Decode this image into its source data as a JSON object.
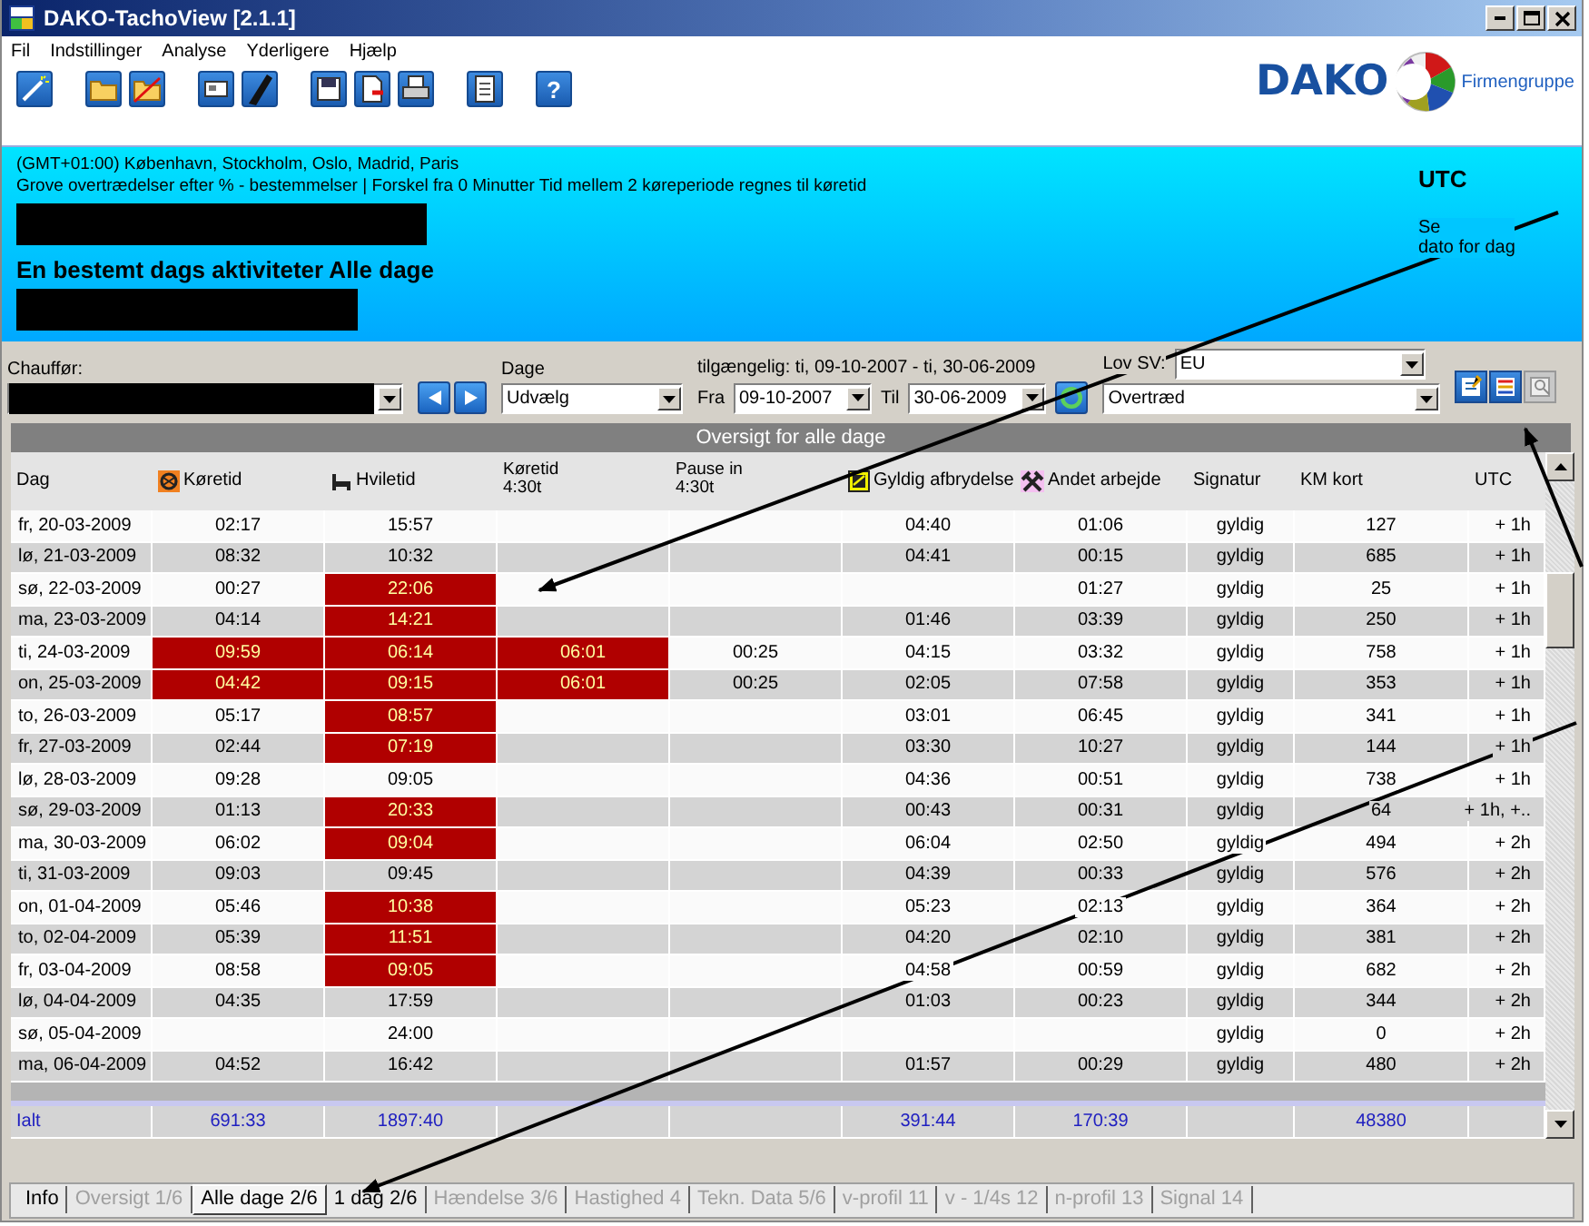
{
  "window": {
    "title": "DAKO-TachoView [2.1.1]"
  },
  "menu": [
    "Fil",
    "Indstillinger",
    "Analyse",
    "Yderligere",
    "Hjælp"
  ],
  "toolbar": [
    [
      {
        "kind": "wand"
      }
    ],
    [
      {
        "kind": "folder"
      },
      {
        "kind": "folder-cross"
      }
    ],
    [
      {
        "kind": "card"
      },
      {
        "kind": "pen"
      }
    ],
    [
      {
        "kind": "save"
      },
      {
        "kind": "export"
      },
      {
        "kind": "print"
      }
    ],
    [
      {
        "kind": "document"
      }
    ],
    [
      {
        "kind": "help",
        "label": "?"
      }
    ]
  ],
  "logo": {
    "text": "DAKO",
    "subtitle": "Firmengruppe"
  },
  "info": {
    "timezone": "(GMT+01:00) København, Stockholm, Oslo, Madrid, Paris",
    "rules": "Grove overtrædelser efter % - bestemmelser | Forskel fra 0 Minutter Tid mellem 2 køreperiode regnes til køretid",
    "heading": "En bestemt dags aktiviteter Alle dage",
    "utc_label": "UTC",
    "date_hint": [
      "Se",
      "dato for dag"
    ]
  },
  "filters": {
    "driver_label": "Chauffør:",
    "days_label": "Dage",
    "days_value": "Udvælg",
    "available": "tilgængelig: ti, 09-10-2007 - ti, 30-06-2009",
    "from_label": "Fra",
    "from_value": "09-10-2007",
    "to_label": "Til",
    "to_value": "30-06-2009",
    "law_label": "Lov SV:",
    "law_value": "EU",
    "mode_value": "Overtræd",
    "view_buttons": [
      {
        "kind": "edit",
        "disabled": false
      },
      {
        "kind": "list",
        "disabled": false
      },
      {
        "kind": "preview",
        "disabled": true
      }
    ]
  },
  "table": {
    "title": "Oversigt for alle dage",
    "columns": [
      {
        "lines": [
          "Dag"
        ],
        "kind": "plain"
      },
      {
        "lines": [
          "Køretid"
        ],
        "kind": "driving"
      },
      {
        "lines": [
          "Hviletid"
        ],
        "kind": "rest"
      },
      {
        "lines": [
          "Køretid",
          "4:30t"
        ],
        "kind": "plain"
      },
      {
        "lines": [
          "Pause in",
          "4:30t"
        ],
        "kind": "plain"
      },
      {
        "lines": [
          "Gyldig afbrydelse"
        ],
        "kind": "break"
      },
      {
        "lines": [
          "Andet arbejde"
        ],
        "kind": "work"
      },
      {
        "lines": [
          "Signatur"
        ],
        "kind": "plain"
      },
      {
        "lines": [
          "KM kort"
        ],
        "kind": "plain"
      },
      {
        "lines": [
          "UTC"
        ],
        "kind": "plain"
      }
    ],
    "rows": [
      {
        "cells": [
          {
            "text": "fr, 20-03-2009"
          },
          {
            "text": "02:17",
            "violation": false
          },
          {
            "text": "15:57",
            "violation": false
          },
          {
            "violation": false
          },
          {},
          {
            "text": "04:40"
          },
          {
            "text": "01:06"
          },
          {
            "text": "gyldig"
          },
          {
            "text": "127"
          },
          {
            "text": "+ 1h"
          }
        ]
      },
      {
        "cells": [
          {
            "text": "lø, 21-03-2009"
          },
          {
            "text": "08:32",
            "violation": false
          },
          {
            "text": "10:32",
            "violation": false
          },
          {
            "violation": false
          },
          {},
          {
            "text": "04:41"
          },
          {
            "text": "00:15"
          },
          {
            "text": "gyldig"
          },
          {
            "text": "685"
          },
          {
            "text": "+ 1h"
          }
        ]
      },
      {
        "cells": [
          {
            "text": "sø, 22-03-2009"
          },
          {
            "text": "00:27",
            "violation": false
          },
          {
            "text": "22:06",
            "violation": true
          },
          {
            "violation": false
          },
          {},
          {},
          {
            "text": "01:27"
          },
          {
            "text": "gyldig"
          },
          {
            "text": "25"
          },
          {
            "text": "+ 1h"
          }
        ]
      },
      {
        "cells": [
          {
            "text": "ma, 23-03-2009"
          },
          {
            "text": "04:14",
            "violation": false
          },
          {
            "text": "14:21",
            "violation": true
          },
          {
            "violation": false
          },
          {},
          {
            "text": "01:46"
          },
          {
            "text": "03:39"
          },
          {
            "text": "gyldig"
          },
          {
            "text": "250"
          },
          {
            "text": "+ 1h"
          }
        ]
      },
      {
        "cells": [
          {
            "text": "ti, 24-03-2009"
          },
          {
            "text": "09:59",
            "violation": true
          },
          {
            "text": "06:14",
            "violation": true
          },
          {
            "text": "06:01",
            "violation": true
          },
          {
            "text": "00:25"
          },
          {
            "text": "04:15"
          },
          {
            "text": "03:32"
          },
          {
            "text": "gyldig"
          },
          {
            "text": "758"
          },
          {
            "text": "+ 1h"
          }
        ]
      },
      {
        "cells": [
          {
            "text": "on, 25-03-2009"
          },
          {
            "text": "04:42",
            "violation": true
          },
          {
            "text": "09:15",
            "violation": true
          },
          {
            "text": "06:01",
            "violation": true
          },
          {
            "text": "00:25"
          },
          {
            "text": "02:05"
          },
          {
            "text": "07:58"
          },
          {
            "text": "gyldig"
          },
          {
            "text": "353"
          },
          {
            "text": "+ 1h"
          }
        ]
      },
      {
        "cells": [
          {
            "text": "to, 26-03-2009"
          },
          {
            "text": "05:17",
            "violation": false
          },
          {
            "text": "08:57",
            "violation": true
          },
          {
            "violation": false
          },
          {},
          {
            "text": "03:01"
          },
          {
            "text": "06:45"
          },
          {
            "text": "gyldig"
          },
          {
            "text": "341"
          },
          {
            "text": "+ 1h"
          }
        ]
      },
      {
        "cells": [
          {
            "text": "fr, 27-03-2009"
          },
          {
            "text": "02:44",
            "violation": false
          },
          {
            "text": "07:19",
            "violation": true
          },
          {
            "violation": false
          },
          {},
          {
            "text": "03:30"
          },
          {
            "text": "10:27"
          },
          {
            "text": "gyldig"
          },
          {
            "text": "144"
          },
          {
            "text": "+ 1h"
          }
        ]
      },
      {
        "cells": [
          {
            "text": "lø, 28-03-2009"
          },
          {
            "text": "09:28",
            "violation": false
          },
          {
            "text": "09:05",
            "violation": false
          },
          {
            "violation": false
          },
          {},
          {
            "text": "04:36"
          },
          {
            "text": "00:51"
          },
          {
            "text": "gyldig"
          },
          {
            "text": "738"
          },
          {
            "text": "+ 1h"
          }
        ]
      },
      {
        "cells": [
          {
            "text": "sø, 29-03-2009"
          },
          {
            "text": "01:13",
            "violation": false
          },
          {
            "text": "20:33",
            "violation": true
          },
          {
            "violation": false
          },
          {},
          {
            "text": "00:43"
          },
          {
            "text": "00:31"
          },
          {
            "text": "gyldig"
          },
          {
            "text": "64"
          },
          {
            "text": "+ 1h, +.."
          }
        ]
      },
      {
        "cells": [
          {
            "text": "ma, 30-03-2009"
          },
          {
            "text": "06:02",
            "violation": false
          },
          {
            "text": "09:04",
            "violation": true
          },
          {
            "violation": false
          },
          {},
          {
            "text": "06:04"
          },
          {
            "text": "02:50"
          },
          {
            "text": "gyldig"
          },
          {
            "text": "494"
          },
          {
            "text": "+ 2h"
          }
        ]
      },
      {
        "cells": [
          {
            "text": "ti, 31-03-2009"
          },
          {
            "text": "09:03",
            "violation": false
          },
          {
            "text": "09:45",
            "violation": false
          },
          {
            "violation": false
          },
          {},
          {
            "text": "04:39"
          },
          {
            "text": "00:33"
          },
          {
            "text": "gyldig"
          },
          {
            "text": "576"
          },
          {
            "text": "+ 2h"
          }
        ]
      },
      {
        "cells": [
          {
            "text": "on, 01-04-2009"
          },
          {
            "text": "05:46",
            "violation": false
          },
          {
            "text": "10:38",
            "violation": true
          },
          {
            "violation": false
          },
          {},
          {
            "text": "05:23"
          },
          {
            "text": "02:13"
          },
          {
            "text": "gyldig"
          },
          {
            "text": "364"
          },
          {
            "text": "+ 2h"
          }
        ]
      },
      {
        "cells": [
          {
            "text": "to, 02-04-2009"
          },
          {
            "text": "05:39",
            "violation": false
          },
          {
            "text": "11:51",
            "violation": true
          },
          {
            "violation": false
          },
          {},
          {
            "text": "04:20"
          },
          {
            "text": "02:10"
          },
          {
            "text": "gyldig"
          },
          {
            "text": "381"
          },
          {
            "text": "+ 2h"
          }
        ]
      },
      {
        "cells": [
          {
            "text": "fr, 03-04-2009"
          },
          {
            "text": "08:58",
            "violation": false
          },
          {
            "text": "09:05",
            "violation": true
          },
          {
            "violation": false
          },
          {},
          {
            "text": "04:58"
          },
          {
            "text": "00:59"
          },
          {
            "text": "gyldig"
          },
          {
            "text": "682"
          },
          {
            "text": "+ 2h"
          }
        ]
      },
      {
        "cells": [
          {
            "text": "lø, 04-04-2009"
          },
          {
            "text": "04:35",
            "violation": false
          },
          {
            "text": "17:59",
            "violation": false
          },
          {
            "violation": false
          },
          {},
          {
            "text": "01:03"
          },
          {
            "text": "00:23"
          },
          {
            "text": "gyldig"
          },
          {
            "text": "344"
          },
          {
            "text": "+ 2h"
          }
        ]
      },
      {
        "cells": [
          {
            "text": "sø, 05-04-2009"
          },
          {
            "violation": false
          },
          {
            "text": "24:00",
            "violation": false
          },
          {
            "violation": false
          },
          {},
          {},
          {},
          {
            "text": "gyldig"
          },
          {
            "text": "0"
          },
          {
            "text": "+ 2h"
          }
        ]
      },
      {
        "cells": [
          {
            "text": "ma, 06-04-2009"
          },
          {
            "text": "04:52",
            "violation": false
          },
          {
            "text": "16:42",
            "violation": false
          },
          {
            "violation": false
          },
          {},
          {
            "text": "01:57"
          },
          {
            "text": "00:29"
          },
          {
            "text": "gyldig"
          },
          {
            "text": "480"
          },
          {
            "text": "+ 2h"
          }
        ]
      }
    ],
    "totals": {
      "day": "Ialt",
      "driving": "691:33",
      "rest": "1897:40",
      "valid_break": "391:44",
      "other_work": "170:39",
      "km": "48380"
    }
  },
  "tabs": [
    {
      "label": "Info",
      "selected": false,
      "disabled": false
    },
    {
      "label": "Oversigt 1/6",
      "selected": false,
      "disabled": true
    },
    {
      "label": "Alle dage 2/6",
      "selected": true,
      "disabled": false
    },
    {
      "label": "1 dag 2/6",
      "selected": false,
      "disabled": false
    },
    {
      "label": "Hændelse 3/6",
      "selected": false,
      "disabled": true
    },
    {
      "label": "Hastighed 4",
      "selected": false,
      "disabled": true
    },
    {
      "label": "Tekn. Data 5/6",
      "selected": false,
      "disabled": true
    },
    {
      "label": "v-profil 11",
      "selected": false,
      "disabled": true
    },
    {
      "label": "v - 1/4s 12",
      "selected": false,
      "disabled": true
    },
    {
      "label": "n-profil 13",
      "selected": false,
      "disabled": true
    },
    {
      "label": "Signal 14",
      "selected": false,
      "disabled": true
    }
  ]
}
